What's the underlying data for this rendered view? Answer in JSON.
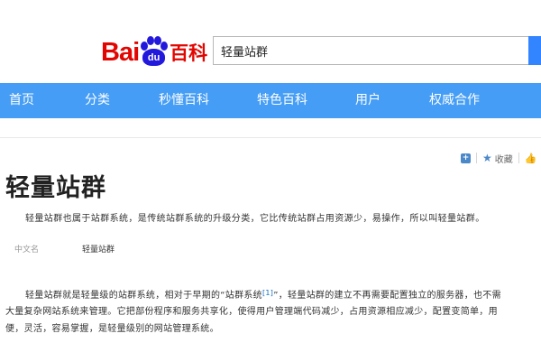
{
  "logo": {
    "bai": "Bai",
    "du": "du",
    "baike": "百科"
  },
  "search": {
    "value": "轻量站群"
  },
  "colors": {
    "brand_red": "#e10601",
    "brand_blue": "#2319dc",
    "nav_bg": "#459df5",
    "link": "#136ec2"
  },
  "nav": {
    "items": [
      {
        "label": "首页"
      },
      {
        "label": "分类"
      },
      {
        "label": "秒懂百科"
      },
      {
        "label": "特色百科"
      },
      {
        "label": "用户"
      },
      {
        "label": "权威合作"
      }
    ]
  },
  "tools": {
    "plus_icon": "+",
    "favorite_label": "收藏"
  },
  "article": {
    "title": "轻量站群",
    "summary": "轻量站群也属于站群系统，是传统站群系统的升级分类，它比传统站群占用资源少，易操作，所以叫轻量站群。",
    "info": {
      "name": "中文名",
      "value": "轻量站群"
    },
    "body": {
      "line1_a": "轻量站群就是轻量级的站群系统，相对于早期的“站群系统",
      "line1_ref": "[1]",
      "line1_b": "”，轻量站群的建立不再需要配置独立的服务器，也不需",
      "line2": "大量复杂网站系统来管理。它把部份程序和服务共享化，使得用户管理端代码减少，占用资源相应减少，配置变简单，用",
      "line3": "便，灵活，容易掌握，是轻量级别的网站管理系统。"
    }
  }
}
